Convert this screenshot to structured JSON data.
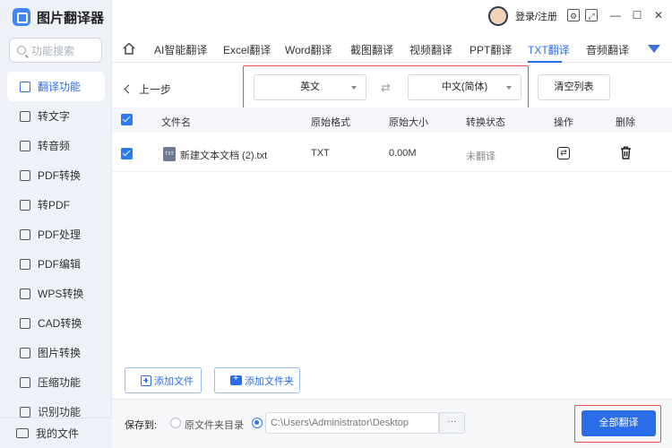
{
  "app": {
    "title": "图片翻译器"
  },
  "search": {
    "placeholder": "功能搜索"
  },
  "sidebar": {
    "items": [
      {
        "label": "翻译功能",
        "icon": "translate-icon",
        "active": true
      },
      {
        "label": "转文字",
        "icon": "text-icon"
      },
      {
        "label": "转音频",
        "icon": "audio-icon"
      },
      {
        "label": "PDF转换",
        "icon": "pdf-convert-icon"
      },
      {
        "label": "转PDF",
        "icon": "to-pdf-icon"
      },
      {
        "label": "PDF处理",
        "icon": "pdf-process-icon"
      },
      {
        "label": "PDF编辑",
        "icon": "pdf-edit-icon"
      },
      {
        "label": "WPS转换",
        "icon": "wps-icon"
      },
      {
        "label": "CAD转换",
        "icon": "cad-icon"
      },
      {
        "label": "图片转换",
        "icon": "image-icon"
      },
      {
        "label": "压缩功能",
        "icon": "compress-icon"
      },
      {
        "label": "识别功能",
        "icon": "recognize-icon"
      }
    ],
    "my_files": "我的文件"
  },
  "header": {
    "user_label": "登录/注册"
  },
  "tabs": [
    {
      "label": "AI智能翻译"
    },
    {
      "label": "Excel翻译"
    },
    {
      "label": "Word翻译"
    },
    {
      "label": "截图翻译"
    },
    {
      "label": "视频翻译"
    },
    {
      "label": "PPT翻译"
    },
    {
      "label": "TXT翻译",
      "active": true
    },
    {
      "label": "音频翻译"
    }
  ],
  "toolbar": {
    "back_label": "上一步",
    "source_lang": "英文",
    "target_lang": "中文(简体)",
    "clear_label": "清空列表"
  },
  "table": {
    "headers": {
      "filename": "文件名",
      "format": "原始格式",
      "size": "原始大小",
      "status": "转换状态",
      "action": "操作",
      "delete": "删除"
    },
    "rows": [
      {
        "filename": "新建文本文档 (2).txt",
        "file_icon_text": "TXT",
        "format": "TXT",
        "size": "0.00M",
        "status": "未翻译"
      }
    ]
  },
  "actions": {
    "add_file": "添加文件",
    "add_folder": "添加文件夹"
  },
  "footer": {
    "save_to_label": "保存到:",
    "option_source_dir": "原文件夹目录",
    "path_value": "C:\\Users\\Administrator\\Desktop",
    "browse_label": "···",
    "translate_all": "全部翻译"
  },
  "colors": {
    "accent": "#2b6de8",
    "highlight": "#e8534a",
    "sidebar_bg": "#eef2f8"
  }
}
